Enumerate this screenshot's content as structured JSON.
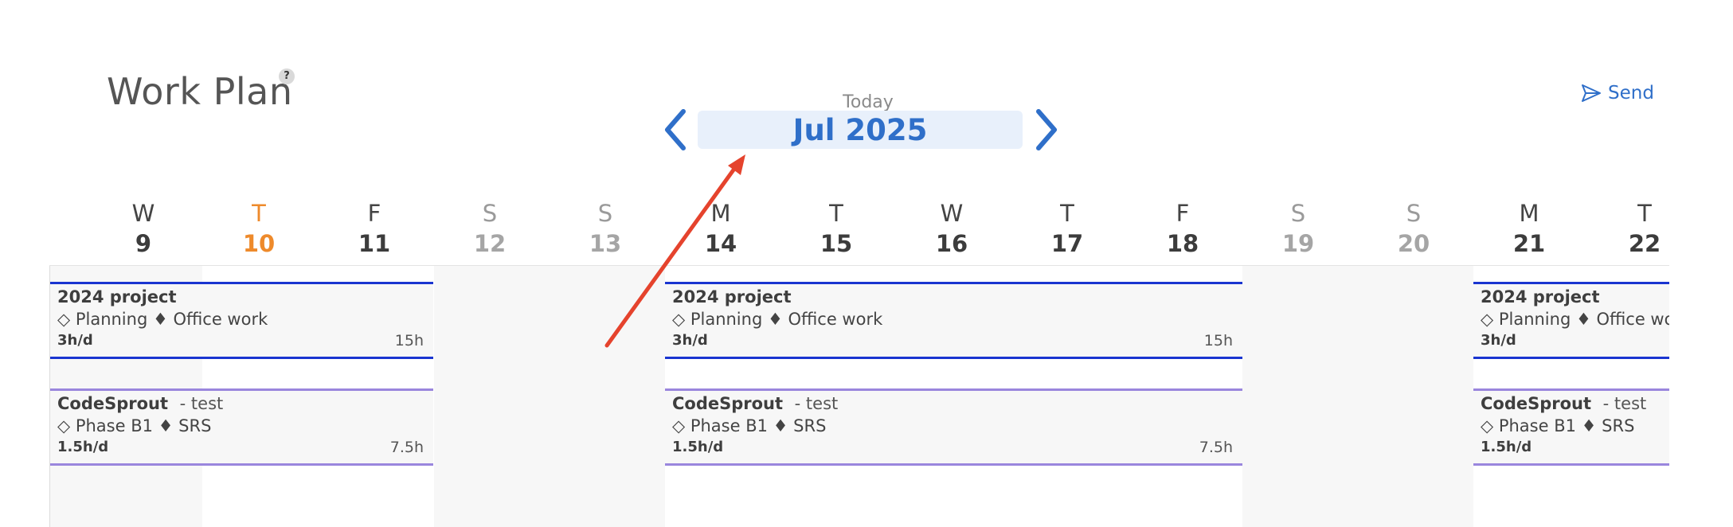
{
  "header": {
    "title": "Work Plan",
    "help_glyph": "?",
    "today_label": "Today",
    "month": "Jul 2025",
    "send_label": "Send",
    "prev_icon": "chevron-left-icon",
    "next_icon": "chevron-right-icon",
    "send_icon": "send-icon"
  },
  "days": [
    {
      "letter": "W",
      "num": "9"
    },
    {
      "letter": "T",
      "num": "10"
    },
    {
      "letter": "F",
      "num": "11"
    },
    {
      "letter": "S",
      "num": "12"
    },
    {
      "letter": "S",
      "num": "13"
    },
    {
      "letter": "M",
      "num": "14"
    },
    {
      "letter": "T",
      "num": "15"
    },
    {
      "letter": "W",
      "num": "16"
    },
    {
      "letter": "T",
      "num": "17"
    },
    {
      "letter": "F",
      "num": "18"
    },
    {
      "letter": "S",
      "num": "19"
    },
    {
      "letter": "S",
      "num": "20"
    },
    {
      "letter": "M",
      "num": "21"
    },
    {
      "letter": "T",
      "num": "22"
    }
  ],
  "tasks": {
    "project": {
      "title": "2024 project",
      "phase": "◇ Planning ♦ Office work",
      "rate": "3h/d",
      "total": "15h"
    },
    "codesprout": {
      "title": "CodeSprout",
      "subtitle": "- test",
      "phase": "◇ Phase B1 ♦ SRS",
      "rate": "1.5h/d",
      "total": "7.5h"
    }
  },
  "colors": {
    "accent": "#2f6fc9",
    "today": "#ee8a2b",
    "project_border": "#1a35d0",
    "codesprout_border": "#9a86dd",
    "annotation_arrow": "#e5432d"
  }
}
